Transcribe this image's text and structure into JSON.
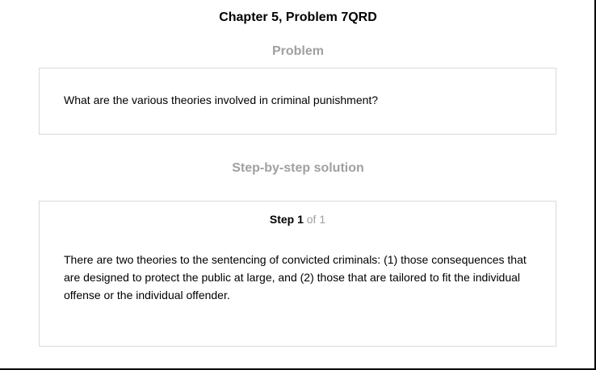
{
  "header": {
    "title": "Chapter 5, Problem 7QRD"
  },
  "problem": {
    "heading": "Problem",
    "text": "What are the various theories involved in criminal punishment?"
  },
  "solution": {
    "heading": "Step-by-step solution",
    "step": {
      "word": "Step 1",
      "of_text": "of 1",
      "text": "There are two theories to the sentencing of convicted criminals: (1) those consequences that are designed to protect the public at large, and (2) those that are tailored to fit the individual offense or the individual offender."
    }
  },
  "colors": {
    "heading_gray": "#a0a0a0",
    "box_border": "#d9d9d9"
  }
}
